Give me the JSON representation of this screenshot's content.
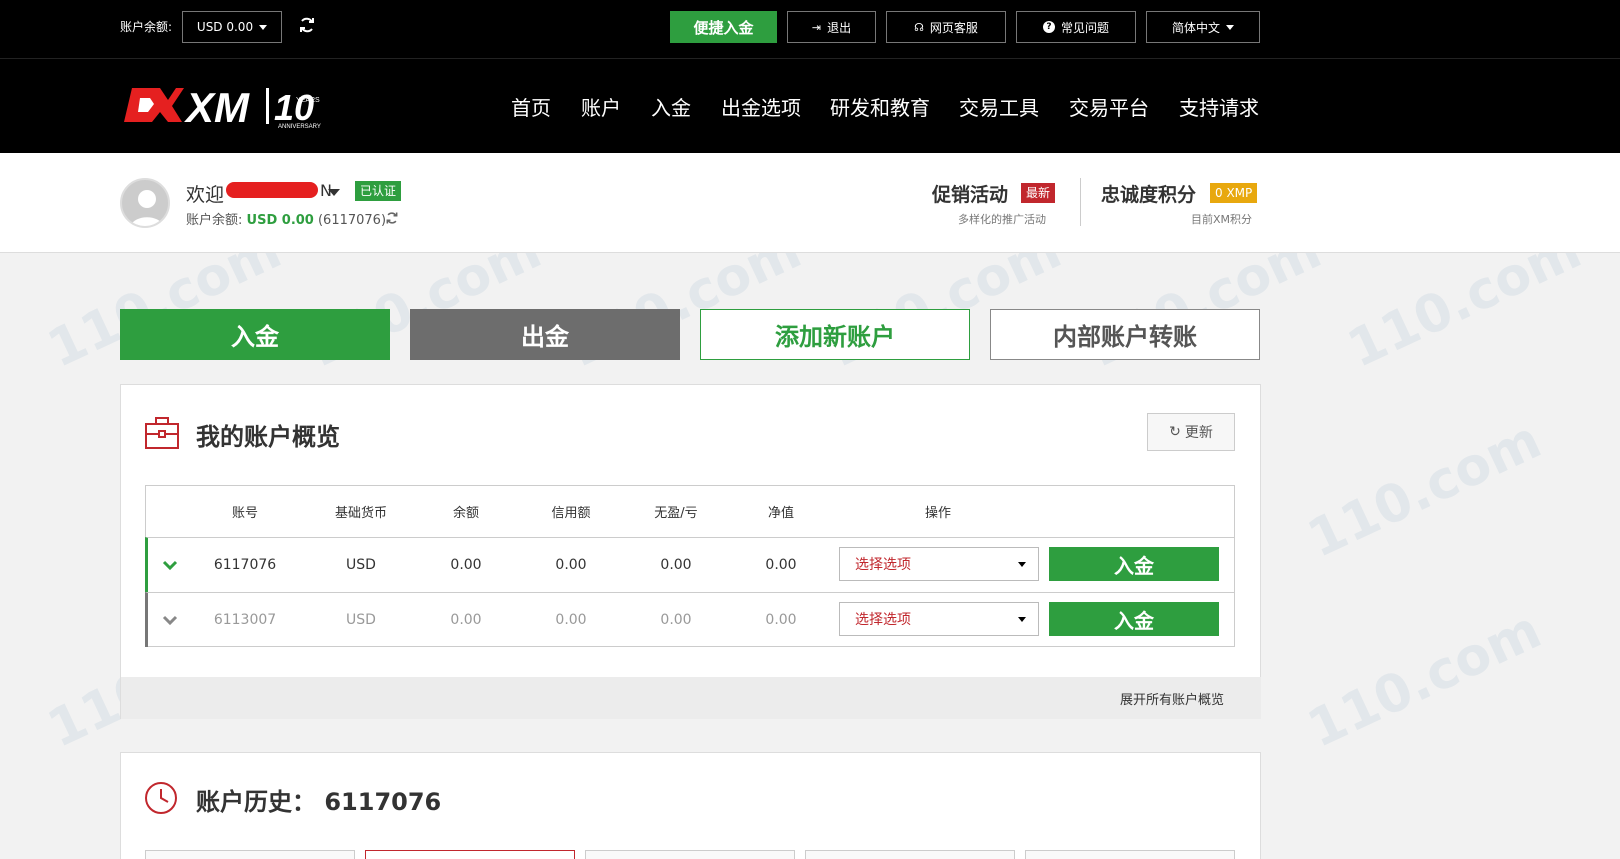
{
  "topbar": {
    "balance_label": "账户余额:",
    "balance_value": "USD 0.00",
    "quick_deposit": "便捷入金",
    "logout": "退出",
    "support": "网页客服",
    "faq": "常见问题",
    "language": "简体中文"
  },
  "nav": {
    "logo_text": "XM",
    "logo_years": "10",
    "logo_years_badge": "YEARS",
    "logo_anniversary": "ANNIVERSARY",
    "items": [
      "首页",
      "账户",
      "入金",
      "出金选项",
      "研发和教育",
      "交易工具",
      "交易平台",
      "支持请求"
    ]
  },
  "user": {
    "welcome": "欢迎",
    "name_tail": "N",
    "verified": "已认证",
    "balance_label": "账户余额:",
    "balance_value": "USD 0.00",
    "account_ref": "(6117076)"
  },
  "promo": {
    "title": "促销活动",
    "badge": "最新",
    "subtitle": "多样化的推广活动"
  },
  "loyalty": {
    "title": "忠诚度积分",
    "badge": "0 XMP",
    "subtitle": "目前XM积分"
  },
  "actions": {
    "deposit": "入金",
    "withdraw": "出金",
    "add_account": "添加新账户",
    "transfer": "内部账户转账"
  },
  "overview": {
    "title": "我的账户概览",
    "refresh": "更新",
    "columns": [
      "账号",
      "基础货币",
      "余额",
      "信用额",
      "无盈/亏",
      "净值",
      "操作"
    ],
    "rows": [
      {
        "account": "6117076",
        "currency": "USD",
        "balance": "0.00",
        "credit": "0.00",
        "pl": "0.00",
        "equity": "0.00",
        "select": "选择选项",
        "action": "入金"
      },
      {
        "account": "6113007",
        "currency": "USD",
        "balance": "0.00",
        "credit": "0.00",
        "pl": "0.00",
        "equity": "0.00",
        "select": "选择选项",
        "action": "入金"
      }
    ],
    "expand": "展开所有账户概览"
  },
  "history": {
    "title": "账户历史：",
    "account": "6117076"
  },
  "watermark": "110.com",
  "colors": {
    "green": "#2e9e3f",
    "red": "#c1272d",
    "gold": "#e8a80e",
    "gray_button": "#6d6d6d"
  }
}
